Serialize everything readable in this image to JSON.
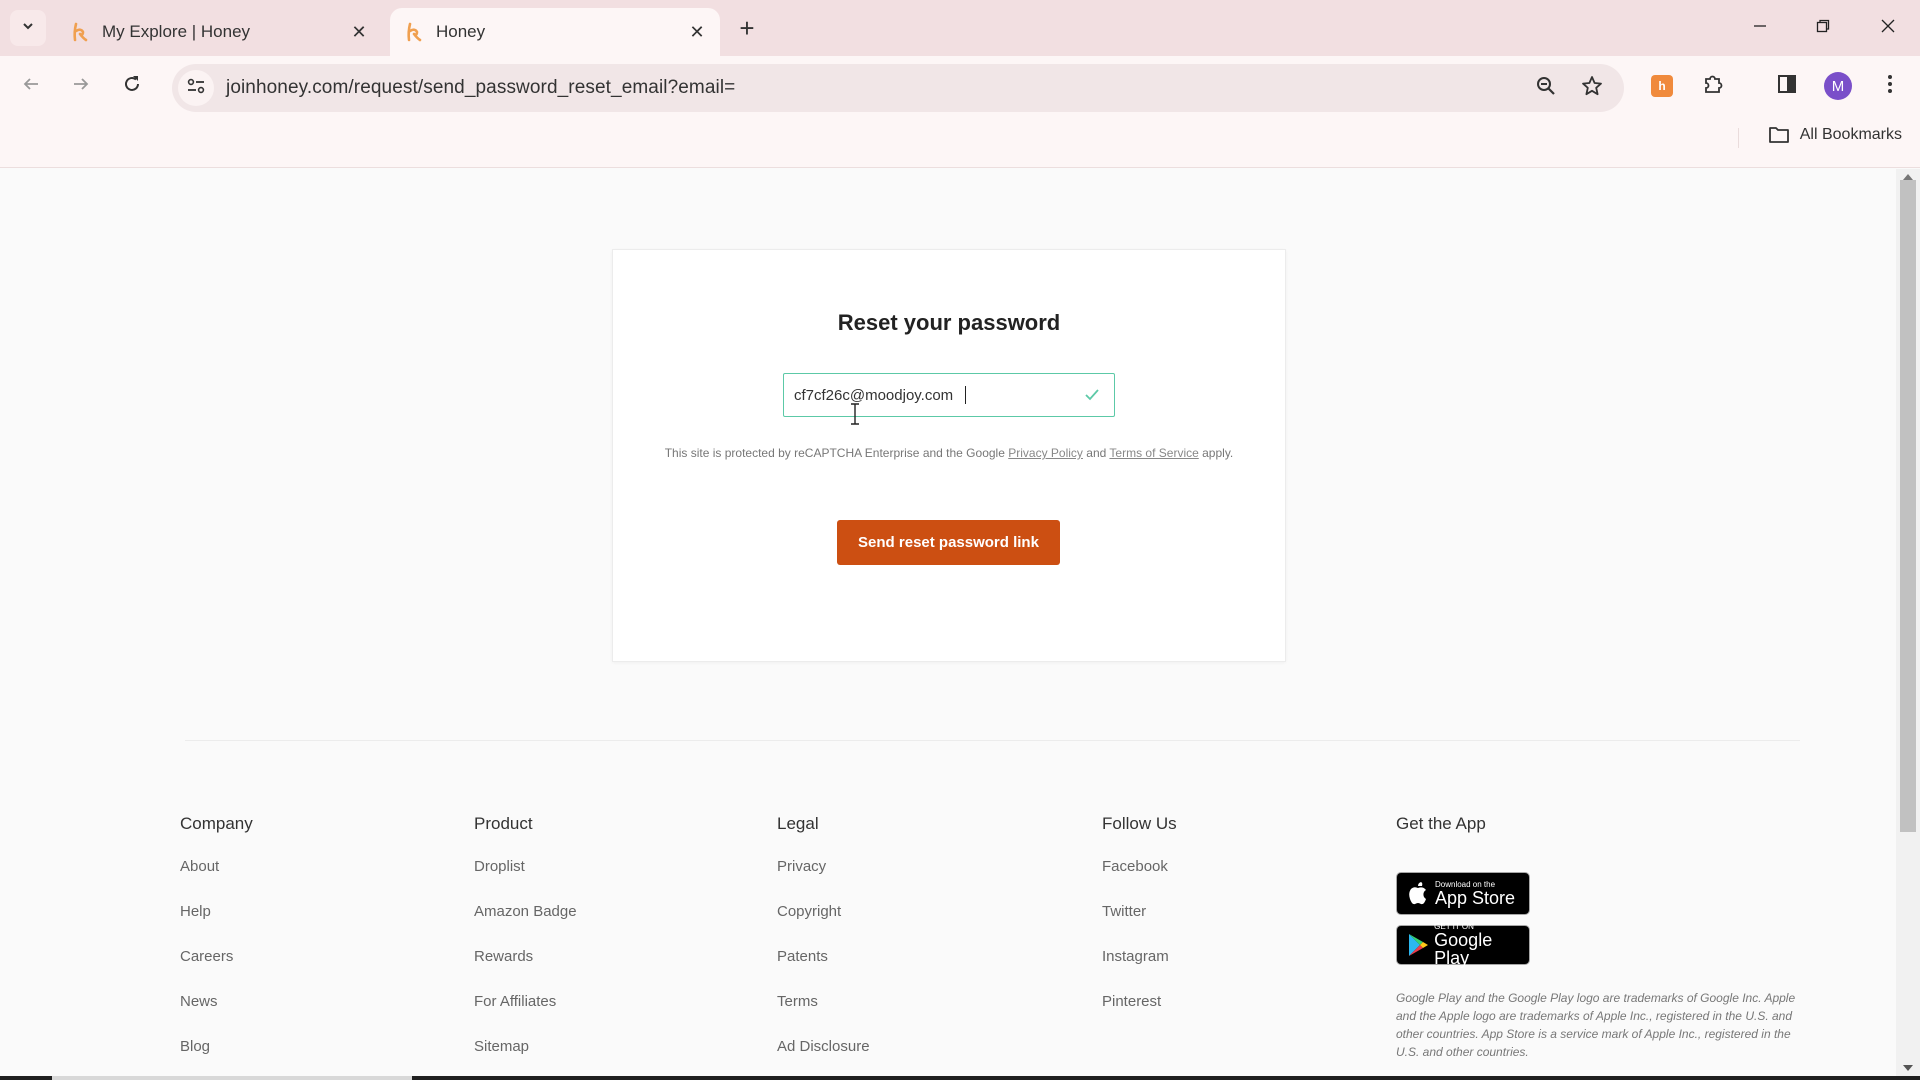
{
  "browser": {
    "tabs": [
      {
        "title": "My Explore | Honey",
        "active": false
      },
      {
        "title": "Honey",
        "active": true
      }
    ],
    "url": "joinhoney.com/request/send_password_reset_email?email=",
    "profile_initial": "M",
    "bookmarks_label": "All Bookmarks",
    "icons": {
      "tab_search": "chevron-down-icon",
      "back": "arrow-left-icon",
      "forward": "arrow-right-icon",
      "reload": "reload-icon",
      "site_info": "tune-icon",
      "zoom": "zoom-out-icon",
      "bookmark": "star-icon",
      "extension_honey": "honey-extension-icon",
      "extensions": "puzzle-icon",
      "side_panel": "side-panel-icon",
      "menu": "kebab-menu-icon"
    }
  },
  "card": {
    "title": "Reset your password",
    "email_value": "cf7cf26c@moodjoy.com",
    "email_valid": true,
    "recaptcha": {
      "prefix": "This site is protected by reCAPTCHA Enterprise and the Google",
      "privacy_link": "Privacy Policy",
      "and": "and",
      "terms_link": "Terms of Service",
      "suffix": "apply."
    },
    "submit_label": "Send reset password link",
    "accent_color": "#cc4f12",
    "valid_border_color": "#5cc9a7"
  },
  "footer": {
    "columns": [
      {
        "heading": "Company",
        "links": [
          "About",
          "Help",
          "Careers",
          "News",
          "Blog"
        ]
      },
      {
        "heading": "Product",
        "links": [
          "Droplist",
          "Amazon Badge",
          "Rewards",
          "For Affiliates",
          "Sitemap"
        ]
      },
      {
        "heading": "Legal",
        "links": [
          "Privacy",
          "Copyright",
          "Patents",
          "Terms",
          "Ad Disclosure"
        ]
      },
      {
        "heading": "Follow Us",
        "links": [
          "Facebook",
          "Twitter",
          "Instagram",
          "Pinterest"
        ]
      }
    ],
    "app": {
      "heading": "Get the App",
      "app_store": {
        "small": "Download on the",
        "big": "App Store"
      },
      "google_play": {
        "small": "GET IT ON",
        "big": "Google Play"
      },
      "legal_note": "Google Play and the Google Play logo are trademarks of Google Inc. Apple and the Apple logo are trademarks of Apple Inc., registered in the U.S. and other countries. App Store is a service mark of Apple Inc., registered in the U.S. and other countries."
    }
  }
}
